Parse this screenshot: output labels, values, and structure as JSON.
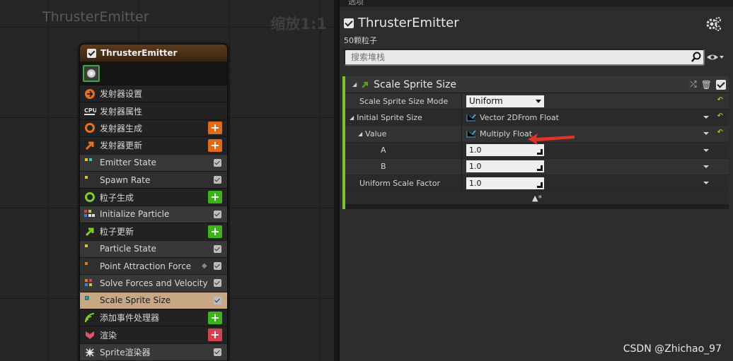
{
  "graph": {
    "title": "ThrusterEmitter",
    "zoom": "缩放1:1"
  },
  "node": {
    "title": "ThrusterEmitter",
    "rows": [
      {
        "label": "发射器设置"
      },
      {
        "label": "发射器属性"
      },
      {
        "label": "发射器生成",
        "add": "+"
      },
      {
        "label": "发射器更新",
        "add": "+"
      },
      {
        "label": "Emitter State"
      },
      {
        "label": "Spawn Rate"
      },
      {
        "label": "粒子生成",
        "add": "+"
      },
      {
        "label": "Initialize Particle"
      },
      {
        "label": "粒子更新",
        "add": "+"
      },
      {
        "label": "Particle State"
      },
      {
        "label": "Point Attraction Force"
      },
      {
        "label": "Solve Forces and Velocity"
      },
      {
        "label": "Scale Sprite Size"
      },
      {
        "label": "添加事件处理器",
        "add": "+"
      },
      {
        "label": "渲染",
        "add": "+"
      },
      {
        "label": "Sprite渲染器"
      }
    ]
  },
  "panel": {
    "tab_label": "选项",
    "title": "ThrusterEmitter",
    "subtitle": "50颗粒子",
    "search_placeholder": "搜索堆栈",
    "module_title": "Scale Sprite Size",
    "properties": [
      {
        "name": "Scale Sprite Size Mode",
        "value": "Uniform",
        "kind": "dropdown"
      },
      {
        "name": "Initial Sprite Size",
        "value": "Vector 2DFrom Float",
        "kind": "function"
      },
      {
        "name": "Value",
        "value": "Multiply Float",
        "kind": "function"
      },
      {
        "name": "A",
        "value": "1.0",
        "kind": "number"
      },
      {
        "name": "B",
        "value": "1.0",
        "kind": "number"
      },
      {
        "name": "Uniform Scale Factor",
        "value": "1.0",
        "kind": "number"
      }
    ],
    "footer_glyph": "▲*"
  },
  "watermark": "CSDN @Zhichao_97",
  "colors": {
    "accent_green": "#7cc12b",
    "node_header": "#5c3a1e",
    "selected_row": "#c8a884",
    "add_orange": "#e06a1a",
    "add_green": "#3cb31a",
    "add_red": "#d0424d",
    "annotation_red": "#e8302a"
  }
}
